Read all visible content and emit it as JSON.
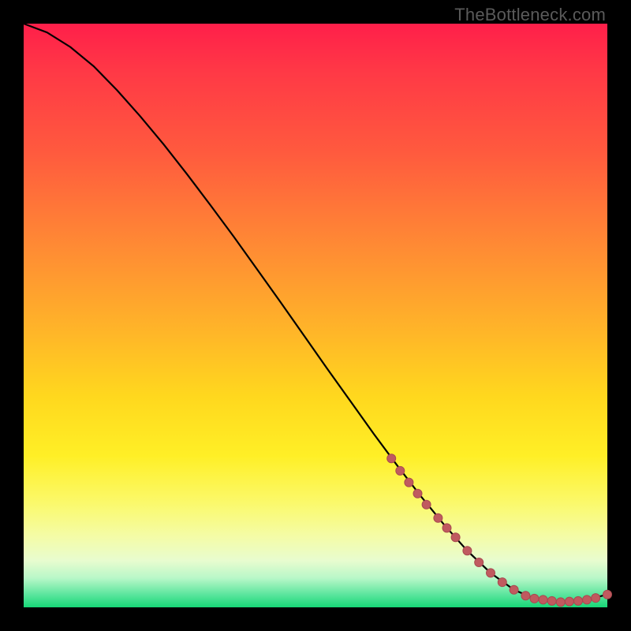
{
  "watermark": "TheBottleneck.com",
  "chart_data": {
    "type": "line",
    "title": "",
    "xlabel": "",
    "ylabel": "",
    "xlim": [
      0,
      100
    ],
    "ylim": [
      0,
      100
    ],
    "grid": false,
    "series": [
      {
        "name": "curve",
        "x": [
          0,
          4,
          8,
          12,
          16,
          20,
          24,
          28,
          32,
          36,
          40,
          44,
          48,
          52,
          56,
          60,
          64,
          68,
          72,
          76,
          80,
          84,
          88,
          92,
          96,
          100
        ],
        "y": [
          100,
          98.5,
          96,
          92.7,
          88.6,
          84.1,
          79.3,
          74.2,
          68.9,
          63.5,
          57.9,
          52.3,
          46.6,
          40.9,
          35.3,
          29.7,
          24.3,
          19.1,
          14.2,
          9.7,
          5.9,
          3.0,
          1.3,
          0.9,
          1.2,
          2.2
        ]
      },
      {
        "name": "markers",
        "x": [
          63,
          64.5,
          66,
          67.5,
          69,
          71,
          72.5,
          74,
          76,
          78,
          80,
          82,
          84,
          86,
          87.5,
          89,
          90.5,
          92,
          93.5,
          95,
          96.5,
          98,
          100
        ],
        "y": [
          25.5,
          23.4,
          21.4,
          19.5,
          17.6,
          15.3,
          13.6,
          12.0,
          9.7,
          7.7,
          5.9,
          4.3,
          3.0,
          2.0,
          1.5,
          1.3,
          1.1,
          0.9,
          1.0,
          1.1,
          1.3,
          1.6,
          2.2
        ]
      }
    ],
    "colors": {
      "curve_stroke": "#000000",
      "marker_fill": "#c05a5f",
      "marker_stroke": "#a84a50"
    },
    "background_gradient": [
      "#ff1f4a",
      "#ff5a3e",
      "#ff8a34",
      "#ffb329",
      "#ffd81e",
      "#ffef26",
      "#fbf96a",
      "#e8fccf",
      "#55e49a",
      "#17d777"
    ]
  }
}
